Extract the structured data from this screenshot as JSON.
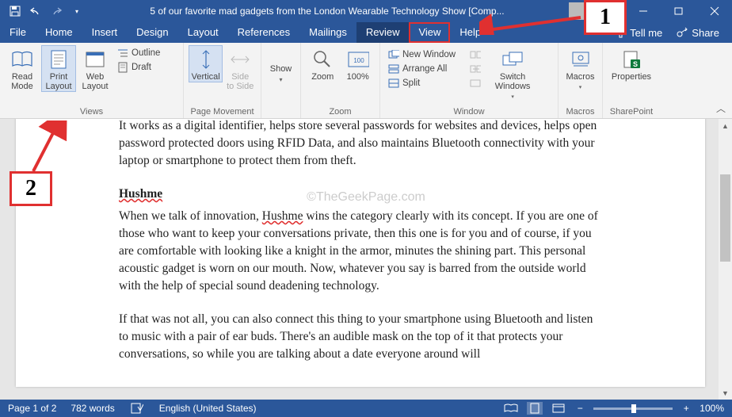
{
  "title": "5 of our favorite mad gadgets from the London Wearable Technology Show [Comp...",
  "qat": {
    "save": "💾",
    "undo": "↶",
    "redo": "↷",
    "custom": "▾"
  },
  "tabs": [
    "File",
    "Home",
    "Insert",
    "Design",
    "Layout",
    "References",
    "Mailings",
    "Review",
    "View",
    "Help"
  ],
  "tell_me": "Tell me",
  "share": "Share",
  "ribbon": {
    "views": {
      "label": "Views",
      "read_mode": "Read\nMode",
      "print_layout": "Print\nLayout",
      "web_layout": "Web\nLayout",
      "outline": "Outline",
      "draft": "Draft"
    },
    "page_movement": {
      "label": "Page Movement",
      "vertical": "Vertical",
      "side": "Side\nto Side"
    },
    "show": {
      "button": "Show"
    },
    "zoom": {
      "label": "Zoom",
      "zoom": "Zoom",
      "pct": "100%"
    },
    "window": {
      "label": "Window",
      "new_window": "New Window",
      "arrange_all": "Arrange All",
      "split": "Split",
      "switch_windows": "Switch\nWindows"
    },
    "macros": {
      "label": "Macros",
      "button": "Macros"
    },
    "sharepoint": {
      "label": "SharePoint",
      "button": "Properties"
    }
  },
  "document": {
    "p1": "It works as a digital identifier, helps store several passwords for websites and devices, helps open password protected doors using RFID Data, and also maintains Bluetooth connectivity with your laptop or smartphone to protect them from theft.",
    "heading": "Hushme",
    "p2a": "When we talk of innovation, ",
    "p2_u": "Hushme",
    "p2b": " wins the category clearly with its concept. If you are one of those who want to keep your conversations private, then this one is for you and of course, if you are comfortable with looking like a knight in the armor, minutes the shining part. This personal acoustic gadget is worn on our mouth. Now, whatever you say is barred from the outside world with the help of special sound deadening technology.",
    "p3": "If that was not all, you can also connect this thing to your smartphone using Bluetooth and listen to music with a pair of ear buds. There's an audible mask on the top of it that protects your conversations, so while you are talking about a date everyone around will"
  },
  "watermark": "©TheGeekPage.com",
  "status": {
    "page": "Page 1 of 2",
    "words": "782 words",
    "language": "English (United States)",
    "zoom": "100%"
  },
  "callouts": {
    "one": "1",
    "two": "2"
  }
}
